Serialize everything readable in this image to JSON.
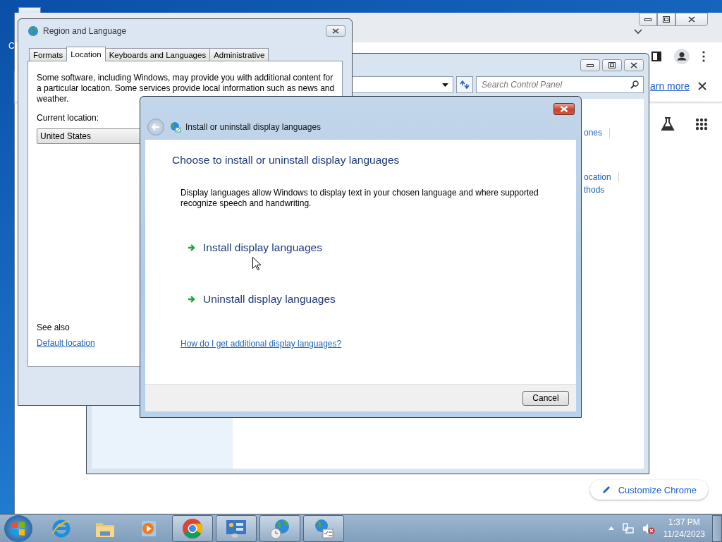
{
  "desktop": {
    "icon_label": "C"
  },
  "chrome": {
    "infobar_link": "arn more",
    "customize_button": "Customize Chrome"
  },
  "control_panel": {
    "search": {
      "placeholder": "Search Control Panel"
    },
    "links": [
      {
        "text": "ones",
        "separator": true
      },
      {
        "text": "ocation",
        "separator": true
      },
      {
        "text": "thods",
        "separator": false
      }
    ]
  },
  "region_dialog": {
    "title": "Region and Language",
    "tabs": [
      {
        "label": "Formats",
        "selected": false
      },
      {
        "label": "Location",
        "selected": true
      },
      {
        "label": "Keyboards and Languages",
        "selected": false
      },
      {
        "label": "Administrative",
        "selected": false
      }
    ],
    "description": "Some software, including Windows, may provide you with additional content for a particular location. Some services provide local information such as news and weather.",
    "location_label": "Current location:",
    "location_value": "United States",
    "see_also": "See also",
    "see_also_link": "Default location"
  },
  "install_dialog": {
    "title": "Install or uninstall display languages",
    "heading": "Choose to install or uninstall display languages",
    "description": "Display languages allow Windows to display text in your chosen language and where supported recognize speech and handwriting.",
    "options": [
      {
        "label": "Install display languages"
      },
      {
        "label": "Uninstall display languages"
      }
    ],
    "help_link": "How do I get additional display languages?",
    "cancel": "Cancel"
  },
  "taskbar": {
    "items": [
      {
        "kind": "browser-e",
        "open": false
      },
      {
        "kind": "folder",
        "open": false
      },
      {
        "kind": "media",
        "open": false
      },
      {
        "kind": "chrome",
        "open": true
      },
      {
        "kind": "panel",
        "open": true
      },
      {
        "kind": "globe-clock",
        "open": true
      },
      {
        "kind": "globe-list",
        "open": true
      }
    ],
    "clock": {
      "time": "1:37 PM",
      "date": "11/24/2023"
    }
  }
}
